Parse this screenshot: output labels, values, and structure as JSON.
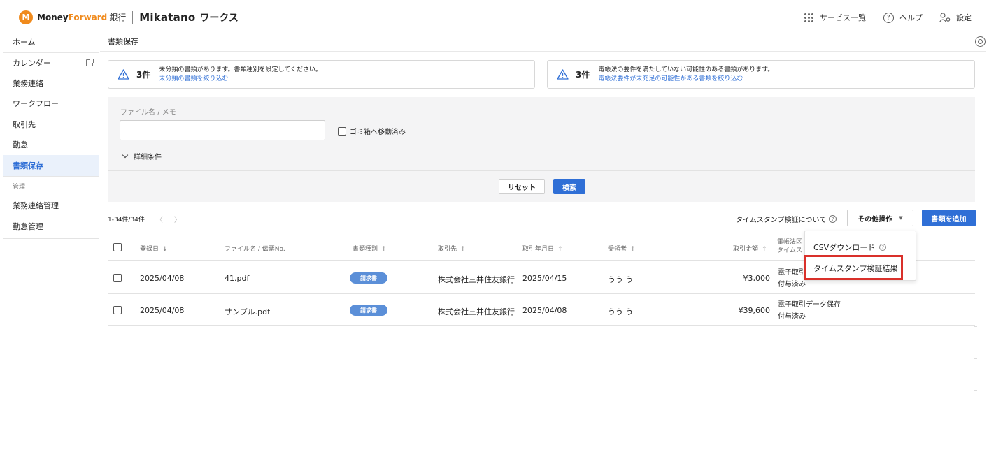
{
  "header": {
    "brand_mf_prefix": "Money ",
    "brand_mf_suffix": "Forward",
    "brand_bank": "銀行",
    "brand_product": "Mikatano",
    "brand_product_sub": "ワークス",
    "services_label": "サービス一覧",
    "help_label": "ヘルプ",
    "settings_label": "設定"
  },
  "sidebar": {
    "items": [
      {
        "label": "ホーム"
      },
      {
        "label": "カレンダー"
      },
      {
        "label": "業務連絡"
      },
      {
        "label": "ワークフロー"
      },
      {
        "label": "取引先"
      },
      {
        "label": "勤怠"
      },
      {
        "label": "書類保存"
      }
    ],
    "section_label": "管理",
    "admin_items": [
      {
        "label": "業務連絡管理"
      },
      {
        "label": "勤怠管理"
      }
    ]
  },
  "page": {
    "title": "書類保存"
  },
  "alerts": [
    {
      "count": "3件",
      "message": "未分類の書類があります。書類種別を設定してください。",
      "link": "未分類の書類を絞り込む"
    },
    {
      "count": "3件",
      "message": "電帳法の要件を満たしていない可能性のある書類があります。",
      "link": "電帳法要件が未充足の可能性がある書類を絞り込む"
    }
  ],
  "search": {
    "field_label": "ファイル名 / メモ",
    "field_value": "",
    "trash_label": "ゴミ箱へ移動済み",
    "detail_label": "詳細条件",
    "reset_label": "リセット",
    "search_label": "検索"
  },
  "toolbar": {
    "pager": "1-34件/34件",
    "prev": "〈",
    "next": "〉",
    "timestamp_about": "タイムスタンプ検証について",
    "other_actions": "その他操作",
    "add_document": "書類を追加"
  },
  "table": {
    "columns": {
      "registered": "登録日",
      "filename": "ファイル名 / 伝票No.",
      "doc_type": "書類種別",
      "partner": "取引先",
      "trade_date": "取引年月日",
      "receiver": "受領者",
      "amount": "取引金額",
      "law_line1": "電帳法区",
      "law_line2": "タイムス"
    },
    "rows": [
      {
        "registered": "2025/04/08",
        "filename": "41.pdf",
        "doc_type": "請求書",
        "partner": "株式会社三井住友銀行",
        "trade_date": "2025/04/15",
        "receiver": "うう う",
        "amount": "¥3,000",
        "law_line1": "電子取引",
        "law_line2": "付与済み"
      },
      {
        "registered": "2025/04/08",
        "filename": "サンプル.pdf",
        "doc_type": "請求書",
        "partner": "株式会社三井住友銀行",
        "trade_date": "2025/04/08",
        "receiver": "うう う",
        "amount": "¥39,600",
        "law_line1": "電子取引データ保存",
        "law_line2": "付与済み"
      }
    ]
  },
  "dropdown": {
    "items": [
      {
        "label": "CSVダウンロード"
      },
      {
        "label": "タイムスタンプ検証結果"
      }
    ]
  },
  "colors": {
    "accent": "#2f6fd6",
    "brand_orange": "#f08a1c",
    "highlight_red": "#d9302a",
    "badge_blue": "#5b8fd8"
  }
}
